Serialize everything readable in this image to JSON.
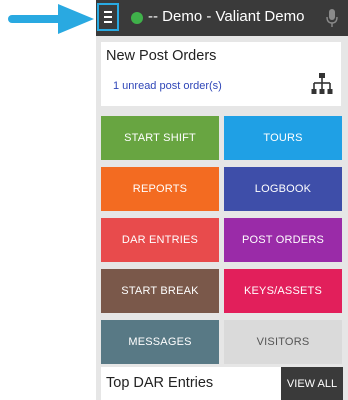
{
  "header": {
    "title": "-- Demo - Valiant Demo",
    "status_color": "#3fb14a"
  },
  "card": {
    "title": "New Post Orders",
    "link": "1 unread post order(s)"
  },
  "tiles": [
    {
      "label": "START SHIFT",
      "color": "#68a541"
    },
    {
      "label": "TOURS",
      "color": "#1fa0e5"
    },
    {
      "label": "REPORTS",
      "color": "#f36b21"
    },
    {
      "label": "LOGBOOK",
      "color": "#3e4ea9"
    },
    {
      "label": "DAR ENTRIES",
      "color": "#e84b4c"
    },
    {
      "label": "POST ORDERS",
      "color": "#9a2ba8"
    },
    {
      "label": "START BREAK",
      "color": "#7a584a"
    },
    {
      "label": "KEYS/ASSETS",
      "color": "#e21f5b"
    },
    {
      "label": "MESSAGES",
      "color": "#587985"
    },
    {
      "label": "VISITORS",
      "color": "#dadada"
    }
  ],
  "bottom": {
    "title": "Top DAR Entries",
    "view_all": "VIEW ALL"
  }
}
